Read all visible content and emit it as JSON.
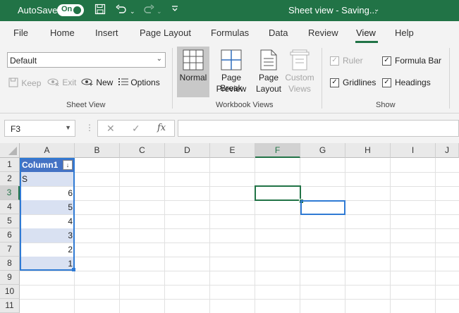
{
  "titlebar": {
    "autosave_label": "AutoSave",
    "autosave_state": "On",
    "doc_title": "Sheet view - Saving...",
    "title_chevron": "⌄",
    "icons": [
      "save-icon",
      "undo-icon",
      "redo-icon",
      "customize-qat-icon"
    ]
  },
  "menu": {
    "items": [
      "File",
      "Home",
      "Insert",
      "Page Layout",
      "Formulas",
      "Data",
      "Review",
      "View",
      "Help"
    ],
    "active": "View"
  },
  "ribbon": {
    "sheet_view": {
      "dropdown_value": "Default",
      "keep": "Keep",
      "exit": "Exit",
      "new": "New",
      "options": "Options",
      "group_label": "Sheet View"
    },
    "workbook_views": {
      "normal": "Normal",
      "page_break_1": "Page Break",
      "page_break_2": "Preview",
      "page_layout_1": "Page",
      "page_layout_2": "Layout",
      "custom_1": "Custom",
      "custom_2": "Views",
      "group_label": "Workbook Views"
    },
    "show": {
      "ruler": "Ruler",
      "gridlines": "Gridlines",
      "formula_bar": "Formula Bar",
      "headings": "Headings",
      "ruler_checked": true,
      "gridlines_checked": true,
      "formula_bar_checked": true,
      "headings_checked": true,
      "group_label": "Show"
    }
  },
  "formula_bar": {
    "name_box": "F3",
    "formula": ""
  },
  "sheet": {
    "columns": [
      "A",
      "B",
      "C",
      "D",
      "E",
      "F",
      "G",
      "H",
      "I",
      "J"
    ],
    "rows": [
      "1",
      "2",
      "3",
      "4",
      "5",
      "6",
      "7",
      "8",
      "9",
      "10",
      "11"
    ],
    "selected_column": "F",
    "selected_row": "3",
    "table_header": "Column1",
    "cells": [
      "S",
      "6",
      "5",
      "4",
      "3",
      "2",
      "1"
    ]
  }
}
